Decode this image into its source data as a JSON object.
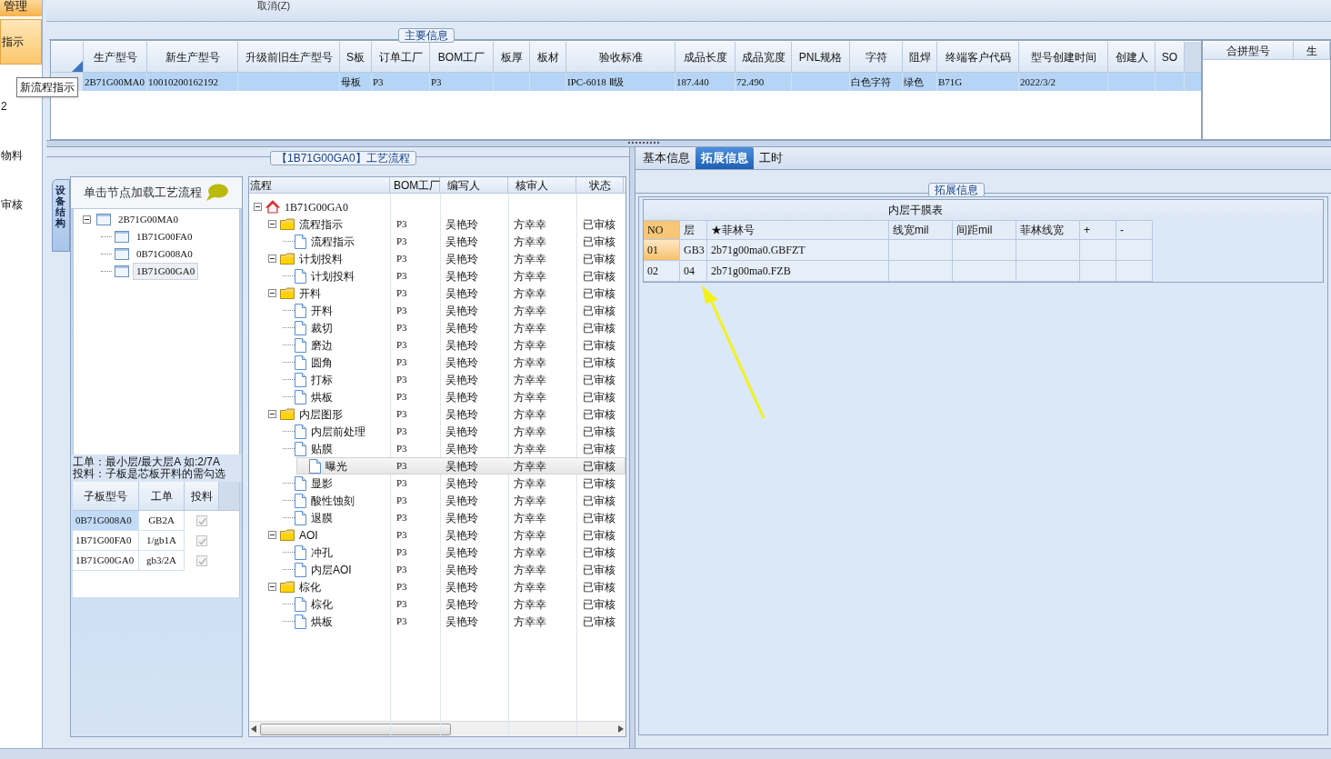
{
  "sidebar": {
    "header": "管理",
    "items": [
      {
        "label": "指示",
        "selected": true
      },
      {
        "label": "2",
        "selected": false
      },
      {
        "label": "物料",
        "selected": false
      },
      {
        "label": "审核",
        "selected": false
      }
    ],
    "tooltip": "新流程指示"
  },
  "toolbar": {
    "button": "取消(Z)"
  },
  "main_info": {
    "legend": "主要信息",
    "columns": [
      "生产型号",
      "新生产型号",
      "升级前旧生产型号",
      "S板",
      "订单工厂",
      "BOM工厂",
      "板厚",
      "板材",
      "验收标准",
      "成品长度",
      "成品宽度",
      "PNL规格",
      "字符",
      "阻焊",
      "终端客户代码",
      "型号创建时间",
      "创建人",
      "SO"
    ],
    "rows": [
      {
        "selected": true,
        "cells": [
          "2B71G00MA0",
          "10010200162192",
          "",
          "母板",
          "P3",
          "P3",
          "",
          "",
          "IPC-6018 Ⅱ级",
          "187.440",
          "72.490",
          "",
          "白色字符",
          "绿色",
          "B71G",
          "2022/3/2",
          "",
          ""
        ]
      }
    ],
    "side_columns": [
      "合拼型号",
      "生"
    ]
  },
  "process": {
    "legend": "【1B71G00GA0】工艺流程",
    "vertical_tab": "设备结构",
    "hint": "单击节点加载工艺流程",
    "structure": [
      {
        "name": "2B71G00MA0",
        "expanded": true,
        "selected": false,
        "children": [
          {
            "name": "1B71G00FA0",
            "selected": false
          },
          {
            "name": "0B71G008A0",
            "selected": false
          },
          {
            "name": "1B71G00GA0",
            "selected": true
          }
        ]
      }
    ],
    "note": [
      "工单：最小层/最大层A 如:2/7A",
      "投料：子板是芯板开料的需勾选"
    ],
    "sub_columns": [
      "子板型号",
      "工单",
      "投料"
    ],
    "sub_rows": [
      {
        "board": "0B71G008A0",
        "order": "GB2A",
        "checked": true,
        "selected": true
      },
      {
        "board": "1B71G00FA0",
        "order": "1/gb1A",
        "checked": true,
        "selected": false
      },
      {
        "board": "1B71G00GA0",
        "order": "gb3/2A",
        "checked": true,
        "selected": false
      }
    ],
    "columns": [
      "流程",
      "BOM工厂",
      "编写人",
      "核审人",
      "状态"
    ],
    "tree": {
      "name": "1B71G00GA0",
      "expanded": true,
      "selected": false,
      "children": [
        {
          "name": "流程指示",
          "bom": "P3",
          "writer": "吴艳玲",
          "reviewer": "方幸幸",
          "status": "已审核",
          "expanded": true,
          "selected": false,
          "children": [
            {
              "name": "流程指示",
              "bom": "P3",
              "writer": "吴艳玲",
              "reviewer": "方幸幸",
              "status": "已审核",
              "selected": false
            }
          ]
        },
        {
          "name": "计划投料",
          "bom": "P3",
          "writer": "吴艳玲",
          "reviewer": "方幸幸",
          "status": "已审核",
          "expanded": true,
          "selected": false,
          "children": [
            {
              "name": "计划投料",
              "bom": "P3",
              "writer": "吴艳玲",
              "reviewer": "方幸幸",
              "status": "已审核",
              "selected": false
            }
          ]
        },
        {
          "name": "开料",
          "bom": "P3",
          "writer": "吴艳玲",
          "reviewer": "方幸幸",
          "status": "已审核",
          "expanded": true,
          "selected": false,
          "children": [
            {
              "name": "开料",
              "bom": "P3",
              "writer": "吴艳玲",
              "reviewer": "方幸幸",
              "status": "已审核",
              "selected": false
            },
            {
              "name": "裁切",
              "bom": "P3",
              "writer": "吴艳玲",
              "reviewer": "方幸幸",
              "status": "已审核",
              "selected": false
            },
            {
              "name": "磨边",
              "bom": "P3",
              "writer": "吴艳玲",
              "reviewer": "方幸幸",
              "status": "已审核",
              "selected": false
            },
            {
              "name": "圆角",
              "bom": "P3",
              "writer": "吴艳玲",
              "reviewer": "方幸幸",
              "status": "已审核",
              "selected": false
            },
            {
              "name": "打标",
              "bom": "P3",
              "writer": "吴艳玲",
              "reviewer": "方幸幸",
              "status": "已审核",
              "selected": false
            },
            {
              "name": "烘板",
              "bom": "P3",
              "writer": "吴艳玲",
              "reviewer": "方幸幸",
              "status": "已审核",
              "selected": false
            }
          ]
        },
        {
          "name": "内层图形",
          "bom": "P3",
          "writer": "吴艳玲",
          "reviewer": "方幸幸",
          "status": "已审核",
          "expanded": true,
          "selected": false,
          "children": [
            {
              "name": "内层前处理",
              "bom": "P3",
              "writer": "吴艳玲",
              "reviewer": "方幸幸",
              "status": "已审核",
              "selected": false
            },
            {
              "name": "贴膜",
              "bom": "P3",
              "writer": "吴艳玲",
              "reviewer": "方幸幸",
              "status": "已审核",
              "selected": false
            },
            {
              "name": "曝光",
              "bom": "P3",
              "writer": "吴艳玲",
              "reviewer": "方幸幸",
              "status": "已审核",
              "selected": true
            },
            {
              "name": "显影",
              "bom": "P3",
              "writer": "吴艳玲",
              "reviewer": "方幸幸",
              "status": "已审核",
              "selected": false
            },
            {
              "name": "酸性蚀刻",
              "bom": "P3",
              "writer": "吴艳玲",
              "reviewer": "方幸幸",
              "status": "已审核",
              "selected": false
            },
            {
              "name": "退膜",
              "bom": "P3",
              "writer": "吴艳玲",
              "reviewer": "方幸幸",
              "status": "已审核",
              "selected": false
            }
          ]
        },
        {
          "name": "AOI",
          "bom": "P3",
          "writer": "吴艳玲",
          "reviewer": "方幸幸",
          "status": "已审核",
          "expanded": true,
          "selected": false,
          "children": [
            {
              "name": "冲孔",
              "bom": "P3",
              "writer": "吴艳玲",
              "reviewer": "方幸幸",
              "status": "已审核",
              "selected": false
            },
            {
              "name": "内层AOI",
              "bom": "P3",
              "writer": "吴艳玲",
              "reviewer": "方幸幸",
              "status": "已审核",
              "selected": false
            }
          ]
        },
        {
          "name": "棕化",
          "bom": "P3",
          "writer": "吴艳玲",
          "reviewer": "方幸幸",
          "status": "已审核",
          "expanded": true,
          "selected": false,
          "children": [
            {
              "name": "棕化",
              "bom": "P3",
              "writer": "吴艳玲",
              "reviewer": "方幸幸",
              "status": "已审核",
              "selected": false
            },
            {
              "name": "烘板",
              "bom": "P3",
              "writer": "吴艳玲",
              "reviewer": "方幸幸",
              "status": "已审核",
              "selected": false
            }
          ]
        }
      ]
    }
  },
  "detail": {
    "tabs": [
      {
        "label": "基本信息",
        "selected": false
      },
      {
        "label": "拓展信息",
        "selected": true
      },
      {
        "label": "工时",
        "selected": false
      }
    ],
    "legend": "拓展信息",
    "table_title": "内层干膜表",
    "columns": [
      "NO",
      "层",
      "★菲林号",
      "线宽mil",
      "间距mil",
      "菲林线宽",
      "+",
      "-"
    ],
    "rows": [
      {
        "selected": true,
        "cells": [
          "01",
          "GB3",
          "2b71g00ma0.GBFZT",
          "",
          "",
          "",
          "",
          ""
        ]
      },
      {
        "selected": false,
        "cells": [
          "02",
          "04",
          "2b71g00ma0.FZB",
          "",
          "",
          "",
          "",
          ""
        ]
      }
    ]
  }
}
